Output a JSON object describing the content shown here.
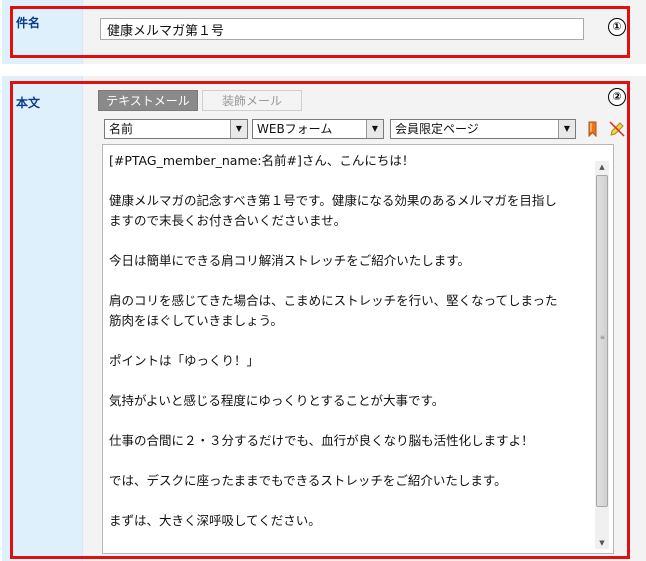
{
  "subject_row": {
    "label": "件名",
    "value": "健康メルマガ第１号",
    "marker": "①"
  },
  "body_row": {
    "label": "本文",
    "marker": "②",
    "tabs": [
      {
        "label": "テキストメール",
        "active": true
      },
      {
        "label": "装飾メール",
        "active": false
      }
    ],
    "toolbar": {
      "select_name": "名前",
      "select_form": "WEBフォーム",
      "select_page": "会員限定ページ",
      "icons": [
        "bookmark-icon",
        "edit-icon"
      ]
    },
    "editor_lines": [
      "[#PTAG_member_name:名前#]さん、こんにちは！",
      "",
      "健康メルマガの記念すべき第１号です。健康になる効果のあるメルマガを目指し",
      "ますので末長くお付き合いくださいませ。",
      "",
      "今日は簡単にできる肩コリ解消ストレッチをご紹介いたします。",
      "",
      "肩のコリを感じてきた場合は、こまめにストレッチを行い、堅くなってしまった",
      "筋肉をほぐしていきましょう。",
      "",
      "ポイントは「ゆっくり！」",
      "",
      "気持がよいと感じる程度にゆっくりとすることが大事です。",
      "",
      "仕事の合間に２・３分するだけでも、血行が良くなり脳も活性化しますよ！",
      "",
      "では、デスクに座ったままでもできるストレッチをご紹介いたします。",
      "",
      "まずは、大きく深呼吸してください。"
    ]
  },
  "colors": {
    "label_bg": "#ddf0fb",
    "label_text": "#0a3a8a",
    "highlight_border": "#e01010"
  }
}
